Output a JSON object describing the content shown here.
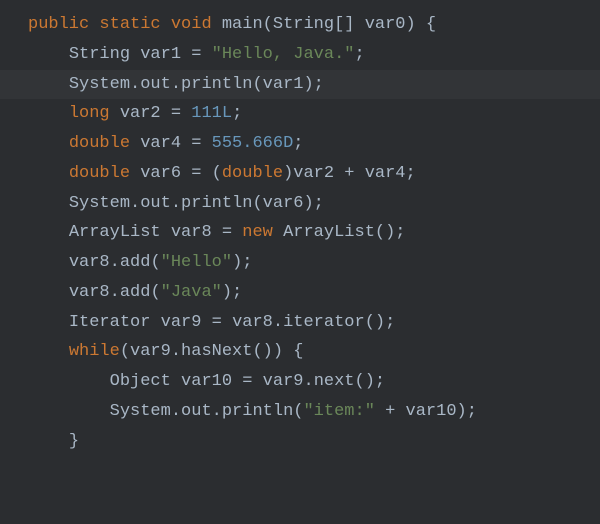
{
  "code": {
    "lines": [
      {
        "indent": 0,
        "tokens": [
          {
            "t": "public ",
            "c": "kw"
          },
          {
            "t": "static ",
            "c": "kw"
          },
          {
            "t": "void ",
            "c": "kw"
          },
          {
            "t": "main",
            "c": "ident"
          },
          {
            "t": "(",
            "c": "punc"
          },
          {
            "t": "String",
            "c": "type"
          },
          {
            "t": "[] ",
            "c": "punc"
          },
          {
            "t": "var0",
            "c": "ident"
          },
          {
            "t": ") {",
            "c": "punc"
          }
        ]
      },
      {
        "indent": 1,
        "tokens": [
          {
            "t": "String ",
            "c": "type"
          },
          {
            "t": "var1 ",
            "c": "ident"
          },
          {
            "t": "= ",
            "c": "op"
          },
          {
            "t": "\"Hello, Java.\"",
            "c": "str"
          },
          {
            "t": ";",
            "c": "punc"
          }
        ]
      },
      {
        "indent": 1,
        "hl": true,
        "tokens": [
          {
            "t": "System",
            "c": "type"
          },
          {
            "t": ".",
            "c": "punc"
          },
          {
            "t": "out",
            "c": "ident"
          },
          {
            "t": ".",
            "c": "punc"
          },
          {
            "t": "println",
            "c": "ident"
          },
          {
            "t": "(",
            "c": "punc"
          },
          {
            "t": "var1",
            "c": "ident"
          },
          {
            "t": ");",
            "c": "punc"
          }
        ]
      },
      {
        "indent": 1,
        "tokens": [
          {
            "t": "long ",
            "c": "kw"
          },
          {
            "t": "var2 ",
            "c": "ident"
          },
          {
            "t": "= ",
            "c": "op"
          },
          {
            "t": "111L",
            "c": "num"
          },
          {
            "t": ";",
            "c": "punc"
          }
        ]
      },
      {
        "indent": 1,
        "tokens": [
          {
            "t": "double ",
            "c": "kw"
          },
          {
            "t": "var4 ",
            "c": "ident"
          },
          {
            "t": "= ",
            "c": "op"
          },
          {
            "t": "555.666D",
            "c": "num"
          },
          {
            "t": ";",
            "c": "punc"
          }
        ]
      },
      {
        "indent": 1,
        "tokens": [
          {
            "t": "double ",
            "c": "kw"
          },
          {
            "t": "var6 ",
            "c": "ident"
          },
          {
            "t": "= ",
            "c": "op"
          },
          {
            "t": "(",
            "c": "punc"
          },
          {
            "t": "double",
            "c": "kw"
          },
          {
            "t": ")",
            "c": "punc"
          },
          {
            "t": "var2 ",
            "c": "ident"
          },
          {
            "t": "+ ",
            "c": "op"
          },
          {
            "t": "var4",
            "c": "ident"
          },
          {
            "t": ";",
            "c": "punc"
          }
        ]
      },
      {
        "indent": 1,
        "tokens": [
          {
            "t": "System",
            "c": "type"
          },
          {
            "t": ".",
            "c": "punc"
          },
          {
            "t": "out",
            "c": "ident"
          },
          {
            "t": ".",
            "c": "punc"
          },
          {
            "t": "println",
            "c": "ident"
          },
          {
            "t": "(",
            "c": "punc"
          },
          {
            "t": "var6",
            "c": "ident"
          },
          {
            "t": ");",
            "c": "punc"
          }
        ]
      },
      {
        "indent": 1,
        "tokens": [
          {
            "t": "ArrayList ",
            "c": "type"
          },
          {
            "t": "var8 ",
            "c": "ident"
          },
          {
            "t": "= ",
            "c": "op"
          },
          {
            "t": "new ",
            "c": "kw"
          },
          {
            "t": "ArrayList",
            "c": "type"
          },
          {
            "t": "();",
            "c": "punc"
          }
        ]
      },
      {
        "indent": 1,
        "tokens": [
          {
            "t": "var8",
            "c": "ident"
          },
          {
            "t": ".",
            "c": "punc"
          },
          {
            "t": "add",
            "c": "ident"
          },
          {
            "t": "(",
            "c": "punc"
          },
          {
            "t": "\"Hello\"",
            "c": "str"
          },
          {
            "t": ");",
            "c": "punc"
          }
        ]
      },
      {
        "indent": 1,
        "tokens": [
          {
            "t": "var8",
            "c": "ident"
          },
          {
            "t": ".",
            "c": "punc"
          },
          {
            "t": "add",
            "c": "ident"
          },
          {
            "t": "(",
            "c": "punc"
          },
          {
            "t": "\"Java\"",
            "c": "str"
          },
          {
            "t": ");",
            "c": "punc"
          }
        ]
      },
      {
        "indent": 1,
        "tokens": [
          {
            "t": "Iterator ",
            "c": "type"
          },
          {
            "t": "var9 ",
            "c": "ident"
          },
          {
            "t": "= ",
            "c": "op"
          },
          {
            "t": "var8",
            "c": "ident"
          },
          {
            "t": ".",
            "c": "punc"
          },
          {
            "t": "iterator",
            "c": "ident"
          },
          {
            "t": "();",
            "c": "punc"
          }
        ]
      },
      {
        "indent": 0,
        "tokens": [
          {
            "t": "",
            "c": "punc"
          }
        ]
      },
      {
        "indent": 1,
        "tokens": [
          {
            "t": "while",
            "c": "kw"
          },
          {
            "t": "(",
            "c": "punc"
          },
          {
            "t": "var9",
            "c": "ident"
          },
          {
            "t": ".",
            "c": "punc"
          },
          {
            "t": "hasNext",
            "c": "ident"
          },
          {
            "t": "()) {",
            "c": "punc"
          }
        ]
      },
      {
        "indent": 2,
        "tokens": [
          {
            "t": "Object ",
            "c": "type"
          },
          {
            "t": "var10 ",
            "c": "ident"
          },
          {
            "t": "= ",
            "c": "op"
          },
          {
            "t": "var9",
            "c": "ident"
          },
          {
            "t": ".",
            "c": "punc"
          },
          {
            "t": "next",
            "c": "ident"
          },
          {
            "t": "();",
            "c": "punc"
          }
        ]
      },
      {
        "indent": 2,
        "tokens": [
          {
            "t": "System",
            "c": "type"
          },
          {
            "t": ".",
            "c": "punc"
          },
          {
            "t": "out",
            "c": "ident"
          },
          {
            "t": ".",
            "c": "punc"
          },
          {
            "t": "println",
            "c": "ident"
          },
          {
            "t": "(",
            "c": "punc"
          },
          {
            "t": "\"item:\" ",
            "c": "str"
          },
          {
            "t": "+ ",
            "c": "op"
          },
          {
            "t": "var10",
            "c": "ident"
          },
          {
            "t": ");",
            "c": "punc"
          }
        ]
      },
      {
        "indent": 1,
        "tokens": [
          {
            "t": "}",
            "c": "punc"
          }
        ]
      }
    ]
  }
}
